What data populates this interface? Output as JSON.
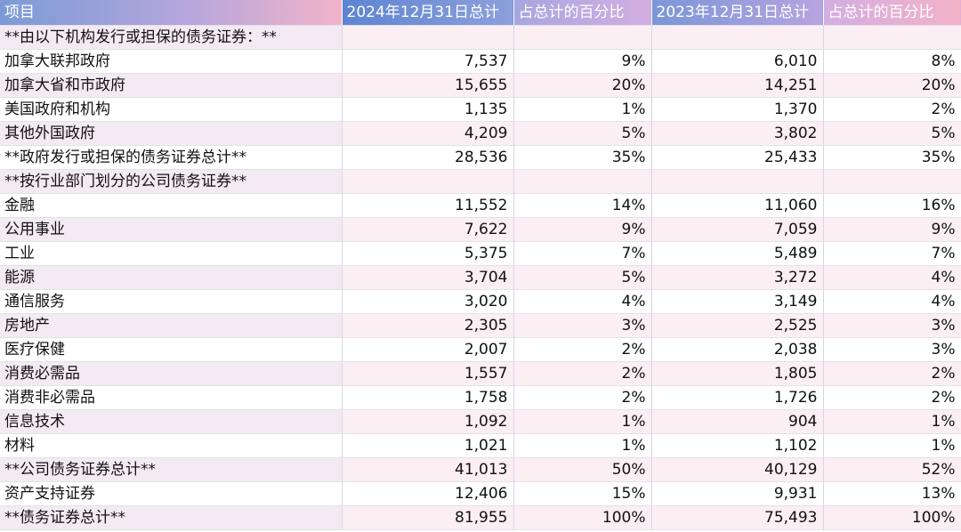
{
  "table": {
    "headers": [
      "项目",
      "2024年12月31日总计",
      "占总计的百分比",
      "2023年12月31日总计",
      "占总计的百分比"
    ],
    "rows": [
      [
        "**由以下机构发行或担保的债务证券：**",
        "",
        "",
        "",
        ""
      ],
      [
        "加拿大联邦政府",
        "7,537",
        "9%",
        "6,010",
        "8%"
      ],
      [
        "加拿大省和市政府",
        "15,655",
        "20%",
        "14,251",
        "20%"
      ],
      [
        "美国政府和机构",
        "1,135",
        "1%",
        "1,370",
        "2%"
      ],
      [
        "其他外国政府",
        "4,209",
        "5%",
        "3,802",
        "5%"
      ],
      [
        "**政府发行或担保的债务证券总计**",
        "28,536",
        "35%",
        "25,433",
        "35%"
      ],
      [
        "**按行业部门划分的公司债务证券**",
        "",
        "",
        "",
        ""
      ],
      [
        "金融",
        "11,552",
        "14%",
        "11,060",
        "16%"
      ],
      [
        "公用事业",
        "7,622",
        "9%",
        "7,059",
        "9%"
      ],
      [
        "工业",
        "5,375",
        "7%",
        "5,489",
        "7%"
      ],
      [
        "能源",
        "3,704",
        "5%",
        "3,272",
        "4%"
      ],
      [
        "通信服务",
        "3,020",
        "4%",
        "3,149",
        "4%"
      ],
      [
        "房地产",
        "2,305",
        "3%",
        "2,525",
        "3%"
      ],
      [
        "医疗保健",
        "2,007",
        "2%",
        "2,038",
        "3%"
      ],
      [
        "消费必需品",
        "1,557",
        "2%",
        "1,805",
        "2%"
      ],
      [
        "消费非必需品",
        "1,758",
        "2%",
        "1,726",
        "2%"
      ],
      [
        "信息技术",
        "1,092",
        "1%",
        "904",
        "1%"
      ],
      [
        "材料",
        "1,021",
        "1%",
        "1,102",
        "1%"
      ],
      [
        "**公司债务证券总计**",
        "41,013",
        "50%",
        "40,129",
        "52%"
      ],
      [
        "资产支持证券",
        "12,406",
        "15%",
        "9,931",
        "13%"
      ],
      [
        "**债务证券总计**",
        "81,955",
        "100%",
        "75,493",
        "100%"
      ]
    ]
  }
}
